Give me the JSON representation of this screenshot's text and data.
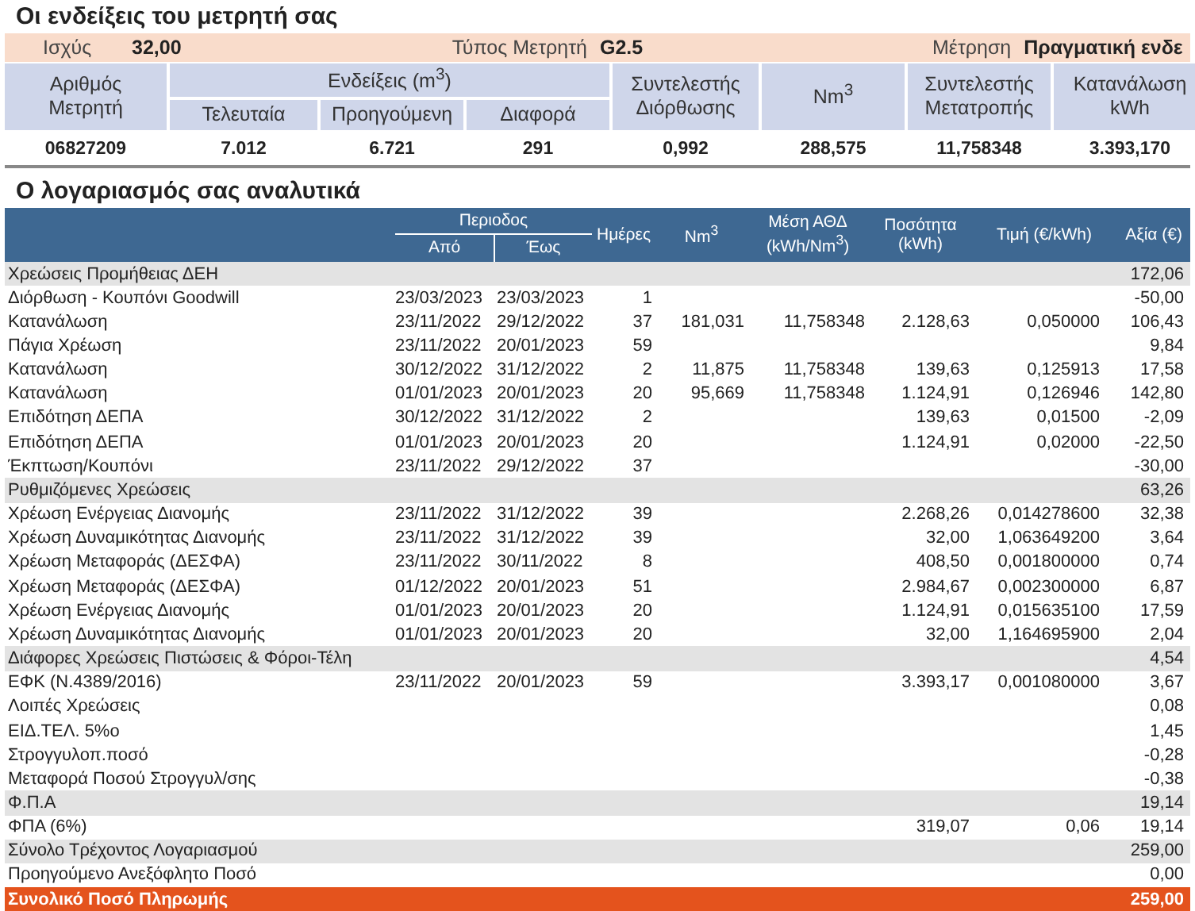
{
  "meter_section": {
    "title": "Οι ενδείξεις του μετρητή σας",
    "info": [
      {
        "label": "Ισχύς",
        "value": "32,00"
      },
      {
        "label": "Τύπος Μετρητή",
        "value": "G2.5"
      },
      {
        "label": "Μέτρηση",
        "value": "Πραγματική ενδε"
      }
    ],
    "headers": {
      "meter_no": "Αριθμός Μετρητή",
      "readings": "Ενδείξεις (m$^{3}$)",
      "last": "Τελευταία",
      "previous": "Προηγούμενη",
      "difference": "Διαφορά",
      "correction": "Συντελεστής Διόρθωσης",
      "nm3": "Nm$^{3}$",
      "conversion": "Συντελεστής Μετατροπής",
      "kwh": "Κατανάλωση kWh"
    },
    "values": [
      "06827209",
      "7.012",
      "6.721",
      "291",
      "0,992",
      "288,575",
      "11,758348",
      "3.393,170"
    ]
  },
  "bill_section": {
    "title": "Ο λογαριασμός σας αναλυτικά",
    "headers": {
      "period": "Περιοδος",
      "from": "Από",
      "to": "Έως",
      "days": "Ημέρες",
      "nm3": "Nm$^{3}$",
      "avg": "Μέση ΑΘΔ (kWh/Nm$^{3}$)",
      "qty": "Ποσότητα (kWh)",
      "price": "Τιμή (€/kWh)",
      "value": "Αξία (€)"
    },
    "rows": [
      {
        "kind": "section",
        "label": "Χρεώσεις Προμήθειας ΔΕΗ",
        "value": "172,06"
      },
      {
        "kind": "item",
        "label": "Διόρθωση - Κουπόνι Goodwill",
        "from": "23/03/2023",
        "to": "23/03/2023",
        "days": "1",
        "value": "-50,00"
      },
      {
        "kind": "item",
        "label": "Κατανάλωση",
        "from": "23/11/2022",
        "to": "29/12/2022",
        "days": "37",
        "nm3": "181,031",
        "avg": "11,758348",
        "qty": "2.128,63",
        "price": "0,050000",
        "value": "106,43"
      },
      {
        "kind": "item",
        "label": "Πάγια Χρέωση",
        "from": "23/11/2022",
        "to": "20/01/2023",
        "days": "59",
        "value": "9,84"
      },
      {
        "kind": "item",
        "label": "Κατανάλωση",
        "from": "30/12/2022",
        "to": "31/12/2022",
        "days": "2",
        "nm3": "11,875",
        "avg": "11,758348",
        "qty": "139,63",
        "price": "0,125913",
        "value": "17,58"
      },
      {
        "kind": "item",
        "label": "Κατανάλωση",
        "from": "01/01/2023",
        "to": "20/01/2023",
        "days": "20",
        "nm3": "95,669",
        "avg": "11,758348",
        "qty": "1.124,91",
        "price": "0,126946",
        "value": "142,80"
      },
      {
        "kind": "item",
        "label": "Επιδότηση ΔΕΠΑ",
        "from": "30/12/2022",
        "to": "31/12/2022",
        "days": "2",
        "qty": "139,63",
        "price": "0,01500",
        "value": "-2,09"
      },
      {
        "kind": "item",
        "label": "Επιδότηση ΔΕΠΑ",
        "from": "01/01/2023",
        "to": "20/01/2023",
        "days": "20",
        "qty": "1.124,91",
        "price": "0,02000",
        "value": "-22,50"
      },
      {
        "kind": "item",
        "label": "Έκπτωση/Κουπόνι",
        "from": "23/11/2022",
        "to": "29/12/2022",
        "days": "37",
        "value": "-30,00"
      },
      {
        "kind": "section",
        "label": "Ρυθμιζόμενες Χρεώσεις",
        "value": "63,26"
      },
      {
        "kind": "item",
        "label": "Χρέωση Ενέργειας Διανομής",
        "from": "23/11/2022",
        "to": "31/12/2022",
        "days": "39",
        "qty": "2.268,26",
        "price": "0,014278600",
        "value": "32,38"
      },
      {
        "kind": "item",
        "label": "Χρέωση Δυναμικότητας Διανομής",
        "from": "23/11/2022",
        "to": "31/12/2022",
        "days": "39",
        "qty": "32,00",
        "price": "1,063649200",
        "value": "3,64"
      },
      {
        "kind": "item",
        "label": "Χρέωση Μεταφοράς (ΔΕΣΦΑ)",
        "from": "23/11/2022",
        "to": "30/11/2022",
        "days": "8",
        "qty": "408,50",
        "price": "0,001800000",
        "value": "0,74"
      },
      {
        "kind": "item",
        "label": "Χρέωση Μεταφοράς (ΔΕΣΦΑ)",
        "from": "01/12/2022",
        "to": "20/01/2023",
        "days": "51",
        "qty": "2.984,67",
        "price": "0,002300000",
        "value": "6,87"
      },
      {
        "kind": "item",
        "label": "Χρέωση Ενέργειας Διανομής",
        "from": "01/01/2023",
        "to": "20/01/2023",
        "days": "20",
        "qty": "1.124,91",
        "price": "0,015635100",
        "value": "17,59"
      },
      {
        "kind": "item",
        "label": "Χρέωση Δυναμικότητας Διανομής",
        "from": "01/01/2023",
        "to": "20/01/2023",
        "days": "20",
        "qty": "32,00",
        "price": "1,164695900",
        "value": "2,04"
      },
      {
        "kind": "section",
        "label": "Διάφορες Χρεώσεις Πιστώσεις & Φόροι-Τέλη",
        "value": "4,54"
      },
      {
        "kind": "item",
        "label": "ΕΦΚ (Ν.4389/2016)",
        "from": "23/11/2022",
        "to": "20/01/2023",
        "days": "59",
        "qty": "3.393,17",
        "price": "0,001080000",
        "value": "3,67"
      },
      {
        "kind": "item",
        "label": "Λοιπές Χρεώσεις",
        "value": "0,08"
      },
      {
        "kind": "item",
        "label": "ΕΙΔ.ΤΕΛ. 5%ο",
        "value": "1,45"
      },
      {
        "kind": "item",
        "label": "Στρογγυλοπ.ποσό",
        "value": "-0,28"
      },
      {
        "kind": "item",
        "label": "Μεταφορά Ποσού Στρογγυλ/σης",
        "value": "-0,38"
      },
      {
        "kind": "section",
        "label": "Φ.Π.Α",
        "value": "19,14"
      },
      {
        "kind": "item",
        "label": "ΦΠΑ (6%)",
        "qty": "319,07",
        "price": "0,06",
        "value": "19,14"
      },
      {
        "kind": "section",
        "label": "Σύνολο Τρέχοντος Λογαριασμού",
        "value": "259,00"
      },
      {
        "kind": "item",
        "label": "Προηγούμενο Ανεξόφλητο Ποσό",
        "value": "0,00"
      },
      {
        "kind": "total",
        "label": "Συνολικό Ποσό Πληρωμής",
        "value": "259,00"
      }
    ]
  }
}
